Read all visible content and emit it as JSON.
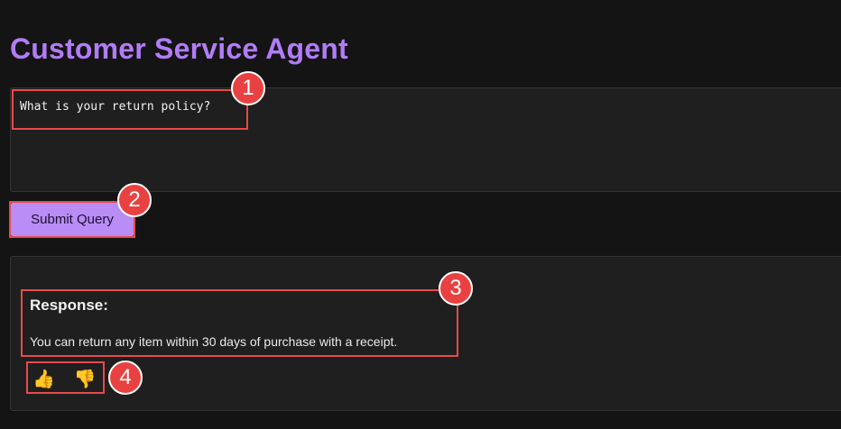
{
  "app": {
    "title": "Customer Service Agent"
  },
  "query": {
    "value": "What is your return policy?"
  },
  "submit": {
    "label": "Submit Query"
  },
  "response": {
    "label": "Response:",
    "text": "You can return any item within 30 days of purchase with a receipt."
  },
  "feedback": {
    "thumbs_up": "👍",
    "thumbs_down": "👎"
  },
  "annotations": {
    "badge_1": "1",
    "badge_2": "2",
    "badge_3": "3",
    "badge_4": "4"
  },
  "colors": {
    "accent": "#b27cf7",
    "button_bg": "#b98cf6",
    "highlight": "#e84a4a",
    "background": "#141414",
    "panel": "#1f1f1f"
  }
}
